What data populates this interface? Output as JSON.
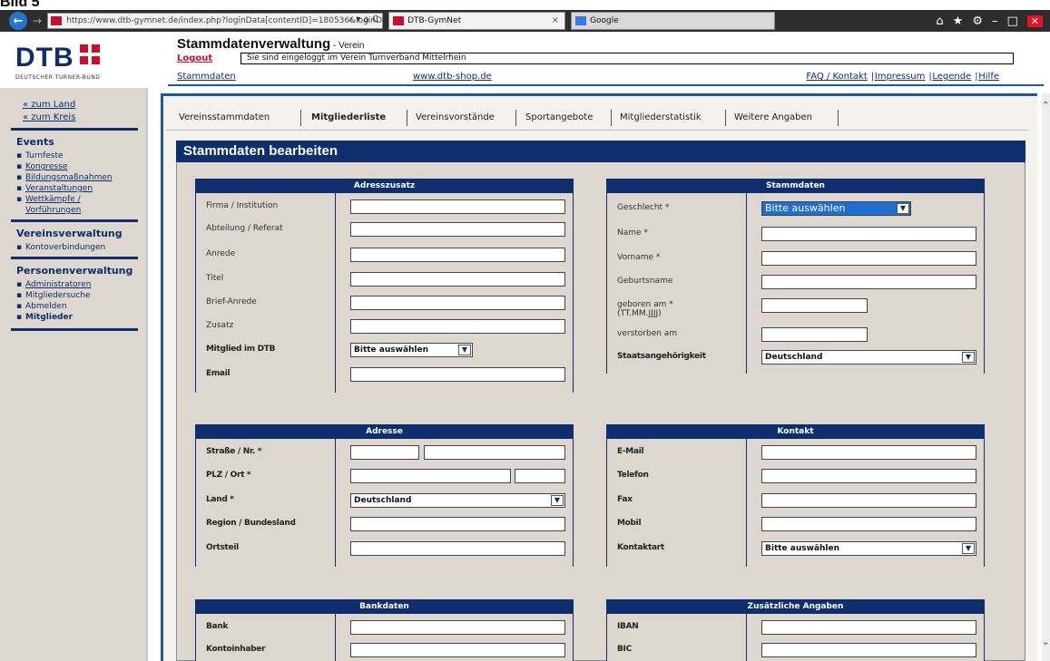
{
  "caption": "Bild 5",
  "browser": {
    "back_icon": "arrow-left-icon",
    "forward_icon": "arrow-right-icon",
    "url": "https://www.dtb-gymnet.de/index.php?loginData[contentID]=180536&loginData[sessionId]=4",
    "url_actions": "⌕ ▾ ⌂ C",
    "tab1_title": "DTB-GymNet",
    "tab2_title": "Google",
    "tab_close": "×",
    "icons": {
      "home": "⌂",
      "star": "★",
      "gear": "⚙",
      "minimize": "–",
      "maximize": "□",
      "close": "✕"
    }
  },
  "header": {
    "logo_text": "DTB",
    "logo_sub": "DEUTSCHER TURNER-BUND",
    "title": "Stammdatenverwaltung",
    "title_sub": " - Verein",
    "logout": "Logout",
    "login_status": "Sie sind eingeloggt im Verein Turnverband Mittelrhein",
    "link_stammdaten": "Stammdaten",
    "link_shop": "www.dtb-shop.de",
    "link_faq": "FAQ / Kontakt",
    "link_impressum": "Impressum",
    "link_legende": "Legende",
    "link_hilfe": "Hilfe",
    "separator": "|"
  },
  "sidebar": {
    "links": [
      "« zum Land",
      "« zum Kreis"
    ],
    "events_title": "Events",
    "events": [
      "Turnfeste",
      "Kongresse",
      "Bildungsmaßnahmen",
      "Veranstaltungen",
      "Wettkämpfe / Vorführungen"
    ],
    "verein_title": "Vereinsverwaltung",
    "verein": [
      "Kontoverbindungen"
    ],
    "person_title": "Personenverwaltung",
    "person": [
      "Administratoren",
      "Mitgliedersuche",
      "Abmelden",
      "Mitglieder"
    ]
  },
  "tabs": [
    "Vereinsstammdaten",
    "Mitgliederliste",
    "Vereinsvorstände",
    "Sportangebote",
    "Mitgliederstatistik",
    "Weitere Angaben"
  ],
  "section_title": "Stammdaten bearbeiten",
  "panels": {
    "adresszusatz": {
      "title": "Adresszusatz",
      "fields": [
        "Firma / Institution",
        "Abteilung / Referat",
        "Anrede",
        "Titel",
        "Brief-Anrede",
        "Zusatz",
        "Mitglied im DTB",
        "Email"
      ],
      "select_value": "Bitte auswählen"
    },
    "stammdaten": {
      "title": "Stammdaten",
      "fields": [
        "Geschlecht *",
        "Name *",
        "Vorname *",
        "Geburtsname",
        "geboren am *\n(TT.MM.JJJJ)",
        "verstorben am",
        "Staatsangehörigkeit"
      ],
      "geschlecht_value": "Bitte auswählen",
      "staat_value": "Deutschland"
    },
    "adresse": {
      "title": "Adresse",
      "fields": [
        "Straße / Nr. *",
        "PLZ / Ort *",
        "Land *",
        "Region / Bundesland",
        "Ortsteil"
      ],
      "land_value": "Deutschland"
    },
    "kontakt": {
      "title": "Kontakt",
      "fields": [
        "E-Mail",
        "Telefon",
        "Fax",
        "Mobil",
        "Kontaktart"
      ],
      "kontaktart_value": "Bitte auswählen"
    },
    "bankdaten": {
      "title": "Bankdaten",
      "fields": [
        "Bank",
        "Kontoinhaber"
      ]
    },
    "zusatz": {
      "title": "Zusätzliche Angaben",
      "fields": [
        "IBAN",
        "BIC"
      ]
    }
  }
}
